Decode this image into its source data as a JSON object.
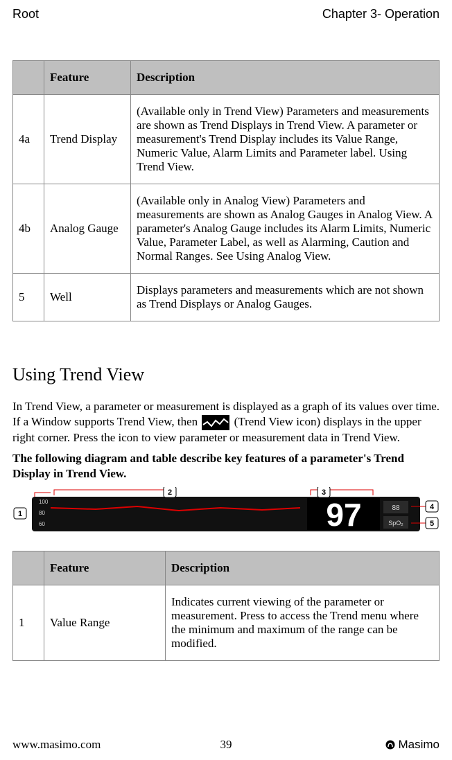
{
  "header": {
    "left": "Root",
    "right": "Chapter 3- Operation"
  },
  "table1": {
    "head": {
      "feature": "Feature",
      "description": "Description"
    },
    "rows": [
      {
        "num": "4a",
        "feature": "Trend Display",
        "description": "(Available only in Trend View) Parameters and measurements are shown as Trend Displays in Trend View. A parameter or measurement's Trend Display includes its Value Range, Numeric Value, Alarm Limits and Parameter label. Using Trend View."
      },
      {
        "num": "4b",
        "feature": "Analog Gauge",
        "description": "(Available only in Analog View) Parameters and measurements are shown as Analog Gauges in Analog View. A parameter's Analog Gauge includes its Alarm Limits, Numeric Value, Parameter Label, as well as Alarming, Caution and Normal Ranges. See Using Analog View."
      },
      {
        "num": "5",
        "feature": "Well",
        "description": "Displays parameters and measurements which are not shown as Trend Displays or Analog Gauges."
      }
    ]
  },
  "section": {
    "title": "Using Trend View",
    "p1a": "In Trend View, a parameter or measurement is displayed as a graph of its values over time. If a Window supports Trend View, then ",
    "p1b": " (Trend View icon) displays in the upper right corner. Press the icon to view parameter or measurement data in Trend View.",
    "p2": "The following diagram and table describe key features of a parameter's Trend Display in Trend View."
  },
  "diagram": {
    "callouts": {
      "c1": "1",
      "c2": "2",
      "c3": "3",
      "c4": "4",
      "c5": "5"
    },
    "yticks": {
      "t1": "100",
      "t2": "80",
      "t3": "60"
    },
    "bignum": "97",
    "tiny_limit": "88",
    "tiny_label": "SpO₂"
  },
  "table2": {
    "head": {
      "feature": "Feature",
      "description": "Description"
    },
    "rows": [
      {
        "num": "1",
        "feature": "Value Range",
        "description": "Indicates current viewing of the parameter or measurement. Press to access the Trend menu where the minimum and maximum of the range can be modified."
      }
    ]
  },
  "footer": {
    "url": "www.masimo.com",
    "page": "39",
    "brand": "Masimo"
  }
}
